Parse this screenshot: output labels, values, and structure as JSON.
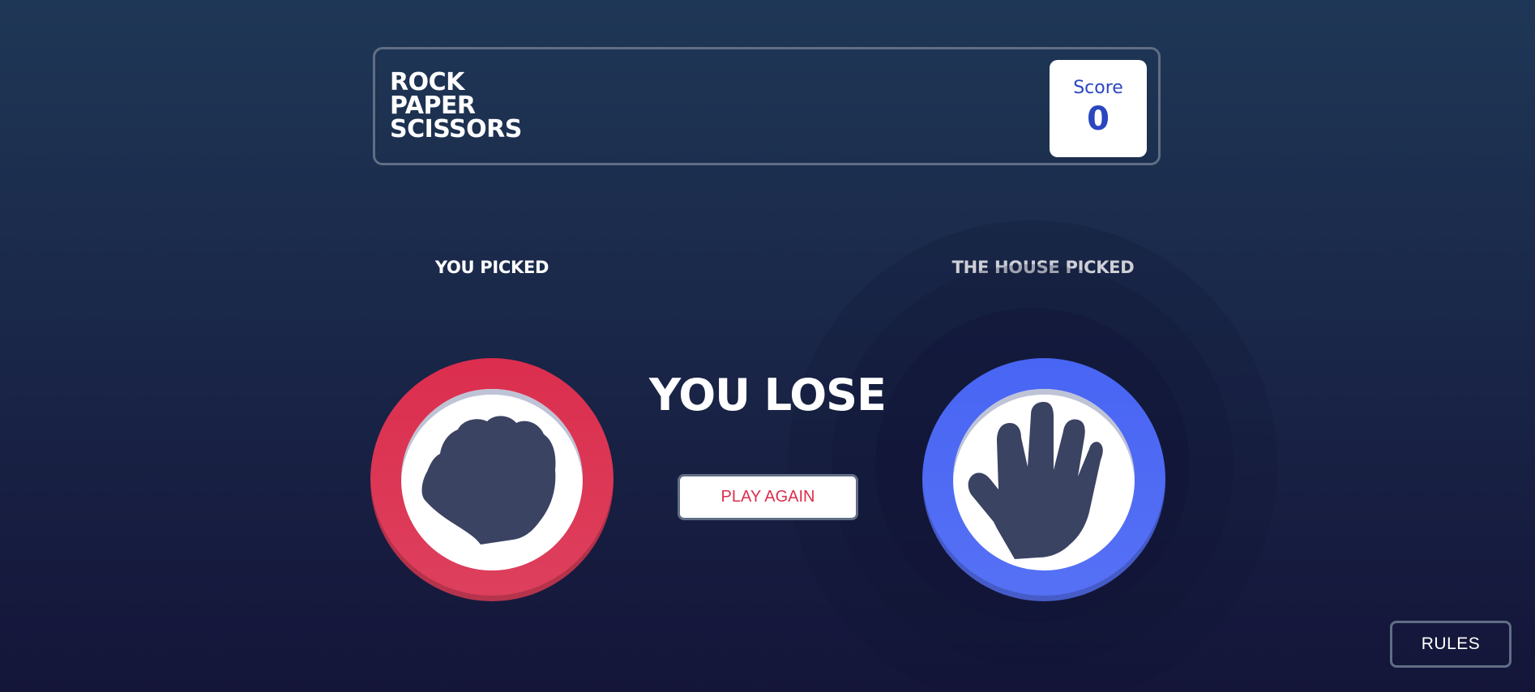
{
  "header": {
    "title_lines": [
      "ROCK",
      "PAPER",
      "SCISSORS"
    ],
    "score_label": "Score",
    "score_value": "0"
  },
  "player": {
    "label": "YOU PICKED",
    "choice": "rock",
    "icon": "rock-hand-icon",
    "ring_color": "#dc2e4e"
  },
  "house": {
    "label": "THE HOUSE PICKED",
    "choice": "paper",
    "icon": "paper-hand-icon",
    "ring_color": "#4865f4"
  },
  "result": {
    "text": "YOU LOSE",
    "play_again_label": "PLAY AGAIN"
  },
  "footer": {
    "rules_label": "RULES"
  },
  "colors": {
    "background_top": "#1f3756",
    "background_bottom": "#141539",
    "score_text": "#2a46c0",
    "play_again_text": "#db2e4d",
    "hand_icon": "#3b4363"
  }
}
